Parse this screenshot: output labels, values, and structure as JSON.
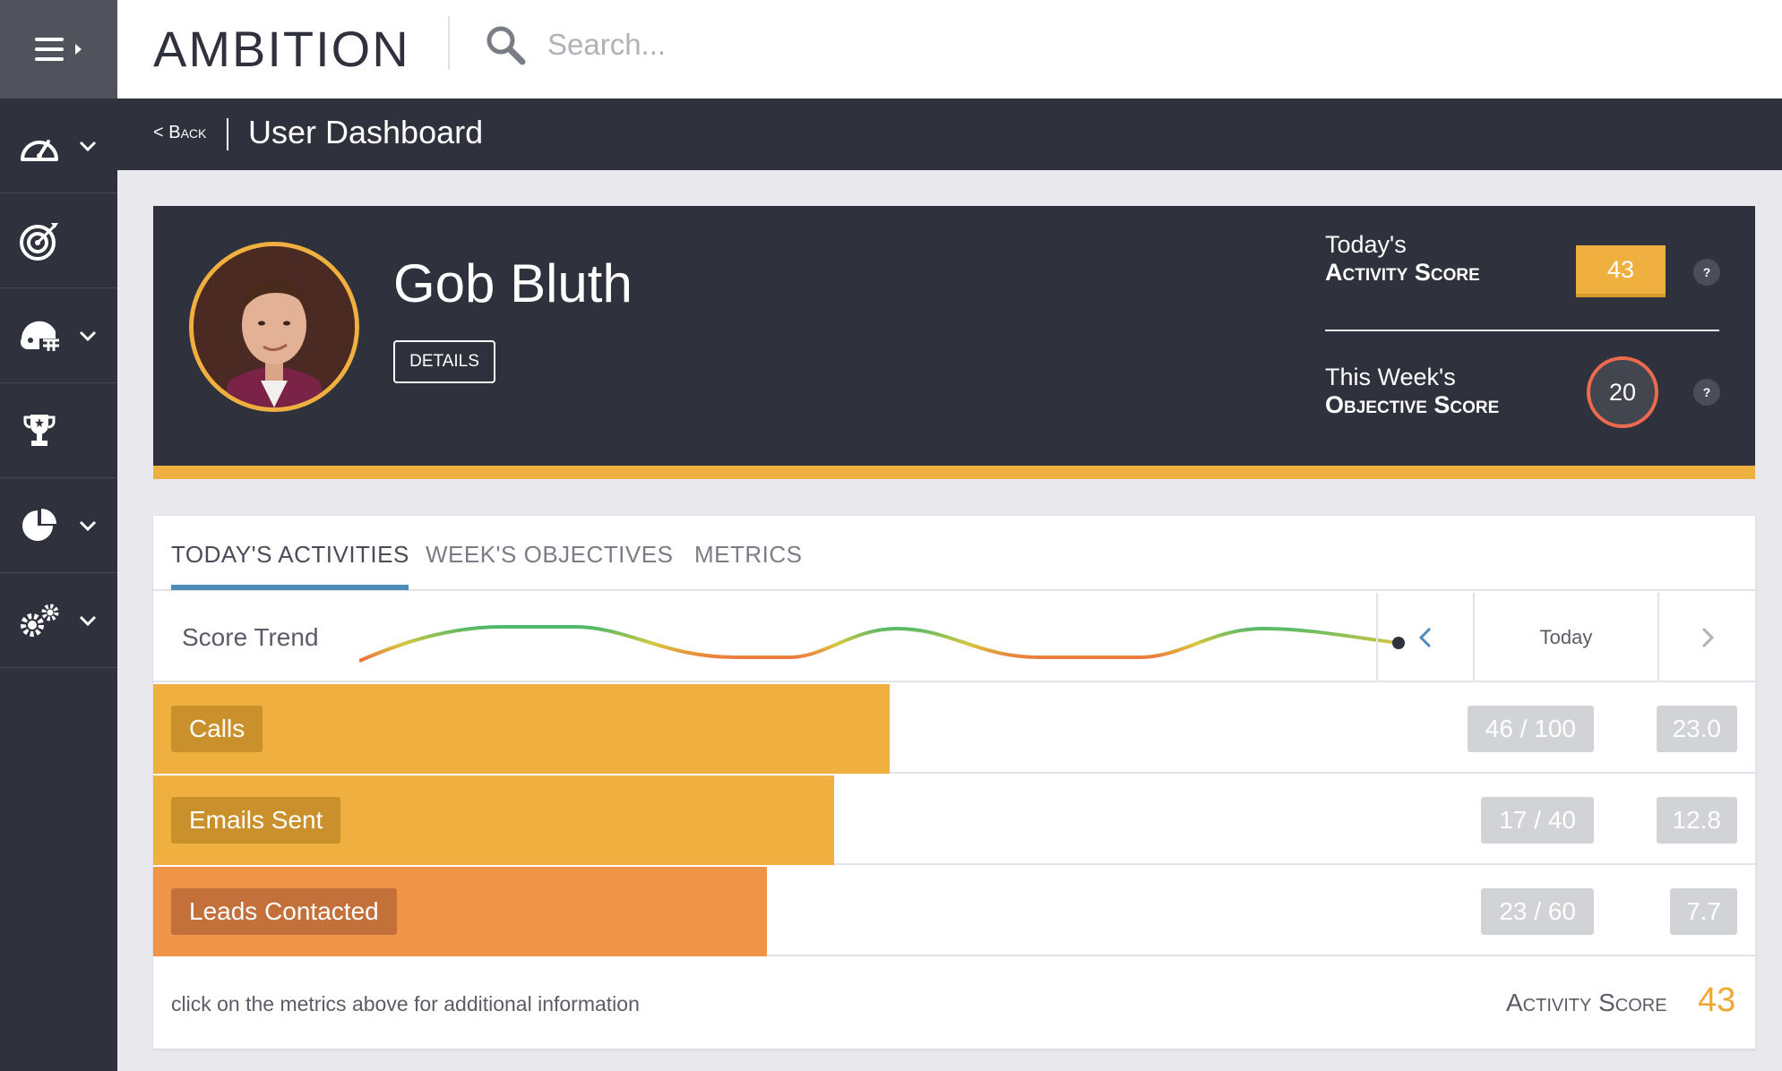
{
  "app": {
    "logo": "AMBITION"
  },
  "search": {
    "placeholder": "Search..."
  },
  "subheader": {
    "back_label": "< Back",
    "title": "User Dashboard"
  },
  "sidebar": {
    "items": [
      {
        "icon": "speedometer-icon",
        "has_submenu": true
      },
      {
        "icon": "target-icon",
        "has_submenu": false
      },
      {
        "icon": "football-helmet-icon",
        "has_submenu": true
      },
      {
        "icon": "trophy-icon",
        "has_submenu": false
      },
      {
        "icon": "pie-chart-icon",
        "has_submenu": true
      },
      {
        "icon": "gears-icon",
        "has_submenu": true
      }
    ]
  },
  "profile": {
    "name": "Gob Bluth",
    "details_label": "DETAILS",
    "activity": {
      "line1": "Today's",
      "line2": "Activity Score",
      "value": "43"
    },
    "objective": {
      "line1": "This Week's",
      "line2": "Objective Score",
      "value": "20"
    },
    "help_label": "?"
  },
  "tabs": {
    "items": [
      "TODAY'S ACTIVITIES",
      "WEEK'S OBJECTIVES",
      "METRICS"
    ],
    "active": 0
  },
  "trend": {
    "label": "Score Trend",
    "period_label": "Today",
    "prev_icon": "chevron-left-icon",
    "next_icon": "chevron-right-icon"
  },
  "metrics": [
    {
      "label": "Calls",
      "ratio": "46 / 100",
      "score": "23.0",
      "fill": 0.46,
      "color": "#f0b040",
      "label_color": "#c9902c"
    },
    {
      "label": "Emails Sent",
      "ratio": "17 / 40",
      "score": "12.8",
      "fill": 0.425,
      "color": "#f0b040",
      "label_color": "#c9902c"
    },
    {
      "label": "Leads Contacted",
      "ratio": "23 / 60",
      "score": "7.7",
      "fill": 0.383,
      "color": "#f09448",
      "label_color": "#c4703a"
    }
  ],
  "footer": {
    "hint": "click on the metrics above for additional information",
    "score_label": "Activity Score",
    "score_value": "43"
  },
  "colors": {
    "accent": "#f0b040",
    "dark": "#2f323c",
    "tab_active": "#4e8bb8",
    "objective_ring": "#ee6a4c"
  }
}
